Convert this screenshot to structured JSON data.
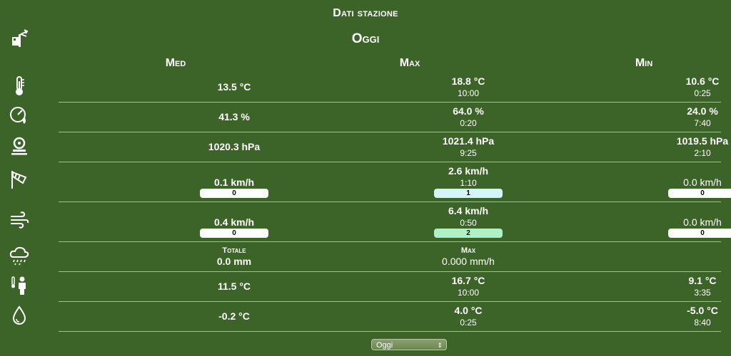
{
  "header": {
    "title": "Dati stazione",
    "period": "Oggi"
  },
  "columns": {
    "avg": "Med",
    "max": "Max",
    "min": "Min"
  },
  "rows": {
    "temperature": {
      "avg": "13.5 °C",
      "max": "18.8 °C",
      "max_time": "10:00",
      "min": "10.6 °C",
      "min_time": "0:25"
    },
    "humidity": {
      "avg": "41.3 %",
      "max": "64.0 %",
      "max_time": "0:20",
      "min": "24.0 %",
      "min_time": "7:40"
    },
    "pressure": {
      "avg": "1020.3 hPa",
      "max": "1021.4 hPa",
      "max_time": "9:25",
      "min": "1019.5 hPa",
      "min_time": "2:10"
    },
    "wind": {
      "avg": "0.1 km/h",
      "avg_bf": "0",
      "max": "2.6 km/h",
      "max_time": "1:10",
      "max_bf": "1",
      "min": "0.0 km/h",
      "min_bf": "0"
    },
    "gust": {
      "avg": "0.4 km/h",
      "avg_bf": "0",
      "max": "6.4 km/h",
      "max_time": "0:50",
      "max_bf": "2",
      "min": "0.0 km/h",
      "min_bf": "0"
    },
    "rain": {
      "total_label": "Totale",
      "total": "0.0 mm",
      "max_label": "Max",
      "max": "0.000 mm/h"
    },
    "apparent": {
      "avg": "11.5 °C",
      "max": "16.7 °C",
      "max_time": "10:00",
      "min": "9.1 °C",
      "min_time": "3:35"
    },
    "dewpoint": {
      "avg": "-0.2 °C",
      "max": "4.0 °C",
      "max_time": "0:25",
      "min": "-5.0 °C",
      "min_time": "8:40"
    }
  },
  "colors": {
    "background": "#3d6428",
    "pill_default": "#ffffff",
    "pill_bf1": "#d4f6fa",
    "pill_bf2": "#aef0c8"
  },
  "icons": [
    "weather-station-icon",
    "thermometer-icon",
    "humidity-gauge-icon",
    "pressure-icon",
    "windsock-icon",
    "wind-gust-icon",
    "rain-cloud-icon",
    "feels-like-person-icon",
    "dewpoint-drop-icon",
    "chevron-updown-icon"
  ],
  "period_select": {
    "value": "Oggi"
  }
}
